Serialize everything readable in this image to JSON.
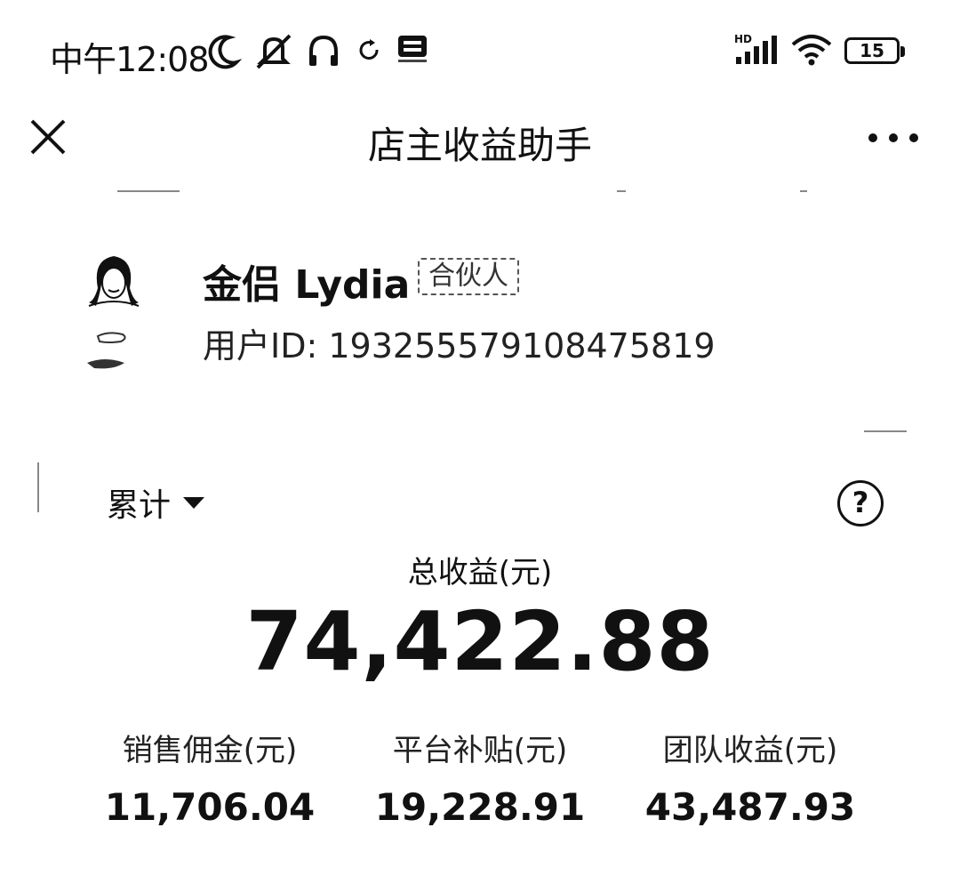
{
  "status_bar": {
    "time": "中午12:08",
    "battery": "15",
    "signal": "HD",
    "icons": [
      "moon-icon",
      "mute-icon",
      "headphones-icon",
      "sync-icon",
      "app-badge-icon",
      "signal-icon",
      "wifi-icon",
      "battery-icon"
    ]
  },
  "header": {
    "title": "店主收益助手",
    "close_icon": "close-icon",
    "more_icon": "more-icon"
  },
  "profile": {
    "name": "金侣 Lydia",
    "badge": "合伙人",
    "user_id_label": "用户ID:",
    "user_id": "1932555791084758​19"
  },
  "earnings": {
    "range_label": "累计",
    "total_label": "总收益(元)",
    "total_value": "74,422.88",
    "stats": [
      {
        "label": "销售佣金(元)",
        "value": "11,706.04"
      },
      {
        "label": "平台补贴(元)",
        "value": "19,228.91"
      },
      {
        "label": "团队收益(元)",
        "value": "43,487.93"
      }
    ]
  }
}
